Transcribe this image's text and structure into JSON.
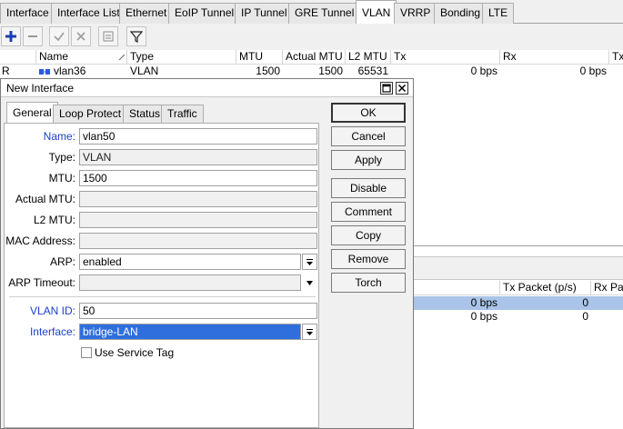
{
  "tabs": [
    "Interface",
    "Interface List",
    "Ethernet",
    "EoIP Tunnel",
    "IP Tunnel",
    "GRE Tunnel",
    "VLAN",
    "VRRP",
    "Bonding",
    "LTE"
  ],
  "active_tab": "VLAN",
  "table": {
    "columns": [
      "Name",
      "Type",
      "MTU",
      "Actual MTU",
      "L2 MTU",
      "Tx",
      "Rx",
      "Tx"
    ],
    "rows": [
      {
        "flag": "R",
        "name": "vlan36",
        "type": "VLAN",
        "mtu": "1500",
        "actual_mtu": "1500",
        "l2_mtu": "65531",
        "tx": "0 bps",
        "rx": "0 bps"
      }
    ]
  },
  "lower_table": {
    "columns": [
      "Tx Packet (p/s)",
      "Rx Pac"
    ],
    "rows": [
      {
        "rate": "0 bps",
        "tx_packet": "0",
        "selected": true
      },
      {
        "rate": "0 bps",
        "tx_packet": "0",
        "selected": false
      }
    ]
  },
  "dialog": {
    "title": "New Interface",
    "tabs": [
      "General",
      "Loop Protect",
      "Status",
      "Traffic"
    ],
    "active_tab": "General",
    "fields": {
      "name": {
        "label": "Name:",
        "value": "vlan50"
      },
      "type": {
        "label": "Type:",
        "value": "VLAN"
      },
      "mtu": {
        "label": "MTU:",
        "value": "1500"
      },
      "actual_mtu": {
        "label": "Actual MTU:",
        "value": ""
      },
      "l2_mtu": {
        "label": "L2 MTU:",
        "value": ""
      },
      "mac_address": {
        "label": "MAC Address:",
        "value": ""
      },
      "arp": {
        "label": "ARP:",
        "value": "enabled"
      },
      "arp_timeout": {
        "label": "ARP Timeout:",
        "value": ""
      },
      "vlan_id": {
        "label": "VLAN ID:",
        "value": "50"
      },
      "interface": {
        "label": "Interface:",
        "value": "bridge-LAN"
      }
    },
    "use_service_tag": {
      "label": "Use Service Tag",
      "checked": false
    },
    "buttons": [
      "OK",
      "Cancel",
      "Apply",
      "Disable",
      "Comment",
      "Copy",
      "Remove",
      "Torch"
    ]
  },
  "colors": {
    "accent_blue_label": "#1c3fd1",
    "selection": "#2f6fdd",
    "row_selected": "#a9c4e8",
    "add_icon": "#1a3fb5"
  }
}
